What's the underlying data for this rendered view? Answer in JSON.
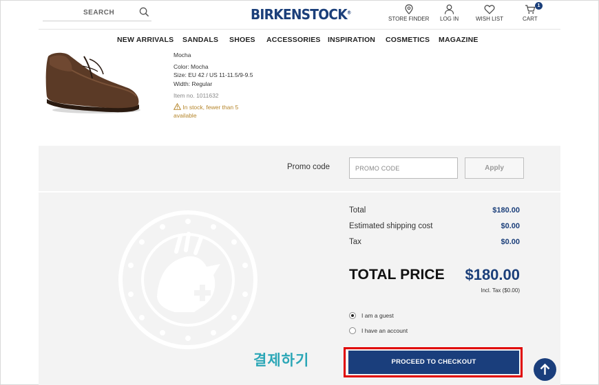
{
  "header": {
    "search_label": "SEARCH",
    "brand": "BIRKENSTOCK",
    "brand_mark": "®",
    "store_finder": "STORE FINDER",
    "log_in": "LOG IN",
    "wish_list": "WISH LIST",
    "cart": "CART",
    "cart_count": "1",
    "accent_color": "#1b3f7a"
  },
  "nav": {
    "items": [
      "NEW ARRIVALS",
      "SANDALS",
      "SHOES",
      "ACCESSORIES",
      "INSPIRATION",
      "COSMETICS",
      "MAGAZINE"
    ]
  },
  "product": {
    "name": "Mocha",
    "color": "Color: Mocha",
    "size": "Size: EU 42 / US 11-11.5/9-9.5",
    "width": "Width: Regular",
    "item_no": "Item no. 1011632",
    "stock_line1": "In stock, fewer than 5",
    "stock_line2": "available",
    "stock_color": "#b5852a"
  },
  "promo": {
    "label": "Promo code",
    "placeholder": "PROMO CODE",
    "apply": "Apply"
  },
  "summary": {
    "total_label": "Total",
    "total_value": "$180.00",
    "shipping_label": "Estimated shipping cost",
    "shipping_value": "$0.00",
    "tax_label": "Tax",
    "tax_value": "$0.00",
    "grand_label": "TOTAL PRICE",
    "grand_value": "$180.00",
    "incl_tax": "Incl. Tax ($0.00)",
    "guest": "I am a guest",
    "account": "I have an account",
    "selected": "guest",
    "checkout": "PROCEED TO CHECKOUT",
    "annotation": "결제하기",
    "annotation_color": "#2aa6b6",
    "highlight_color": "#e00000"
  }
}
